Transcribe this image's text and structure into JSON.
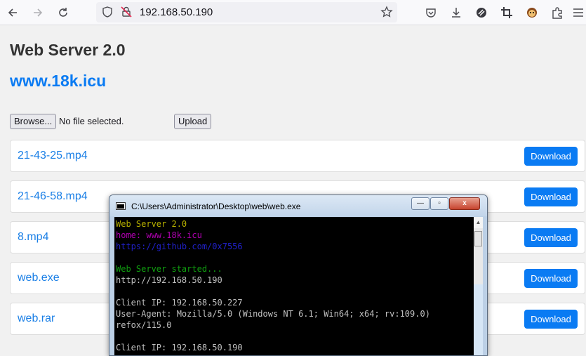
{
  "browser": {
    "url": "192.168.50.190",
    "icons": [
      "back-icon",
      "forward-icon",
      "reload-icon",
      "shield-icon",
      "insecure-lock-icon",
      "star-icon",
      "pocket-icon",
      "download-icon",
      "shield-extension-icon",
      "crop-icon",
      "monkey-extension-icon",
      "puzzle-icon",
      "menu-icon"
    ]
  },
  "page": {
    "title": "Web Server 2.0",
    "link": "www.18k.icu",
    "browse_label": "Browse...",
    "file_status": "No file selected.",
    "upload_label": "Upload",
    "download_label": "Download",
    "files": [
      "21-43-25.mp4",
      "21-46-58.mp4",
      "8.mp4",
      "web.exe",
      "web.rar"
    ]
  },
  "console": {
    "title": "C:\\Users\\Administrator\\Desktop\\web\\web.exe",
    "minimize": "—",
    "maximize": "▫",
    "close": "x",
    "lines": [
      {
        "text": "Web Server 2.0",
        "color": "#b7b000"
      },
      {
        "text": "home: www.18k.icu",
        "color": "#b000b0"
      },
      {
        "text": "https://github.com/0x7556",
        "color": "#2020c8"
      },
      {
        "text": "",
        "color": "#c0c0c0"
      },
      {
        "text": "Web Server started...",
        "color": "#10a010"
      },
      {
        "text": "http://192.168.50.190",
        "color": "#c0c0c0"
      },
      {
        "text": "",
        "color": "#c0c0c0"
      },
      {
        "text": "Client IP: 192.168.50.227",
        "color": "#c0c0c0"
      },
      {
        "text": "User-Agent: Mozilla/5.0 (Windows NT 6.1; Win64; x64; rv:109.0)",
        "color": "#c0c0c0"
      },
      {
        "text": "refox/115.0",
        "color": "#c0c0c0"
      },
      {
        "text": "",
        "color": "#c0c0c0"
      },
      {
        "text": "Client IP: 192.168.50.190",
        "color": "#c0c0c0"
      }
    ]
  }
}
